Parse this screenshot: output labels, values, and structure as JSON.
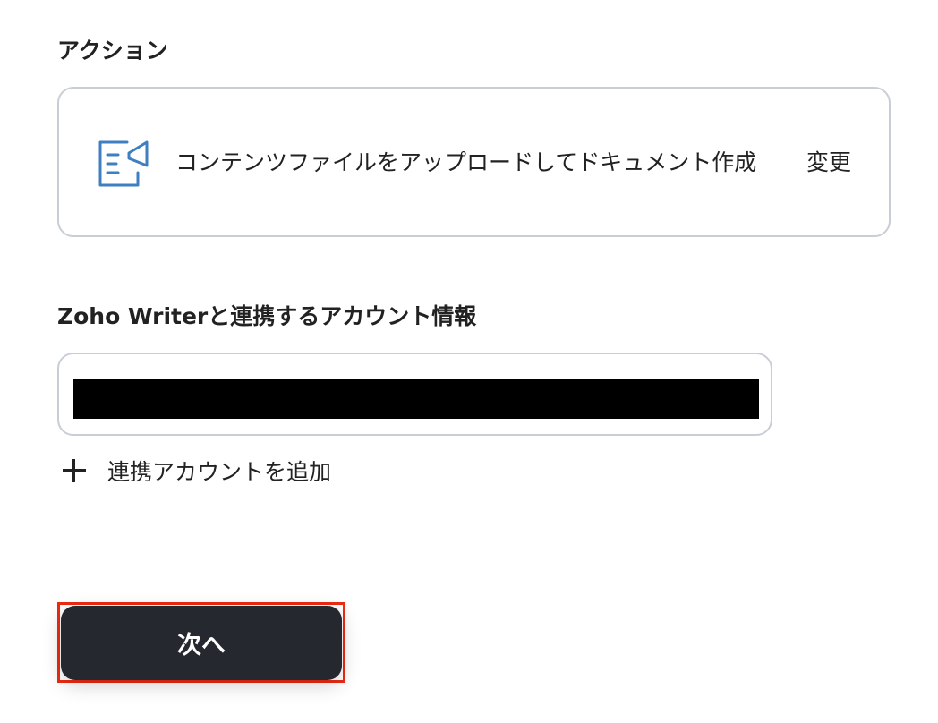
{
  "action_section": {
    "label": "アクション",
    "action_name": "コンテンツファイルをアップロードしてドキュメント作成",
    "change_label": "変更",
    "icon": "document-share-icon",
    "icon_color": "#3d7fc1"
  },
  "account_section": {
    "label": "Zoho Writerと連携するアカウント情報",
    "add_account_label": "連携アカウントを追加"
  },
  "footer": {
    "next_label": "次へ",
    "button_color": "#25282e",
    "highlight_color": "#ee2a12"
  }
}
